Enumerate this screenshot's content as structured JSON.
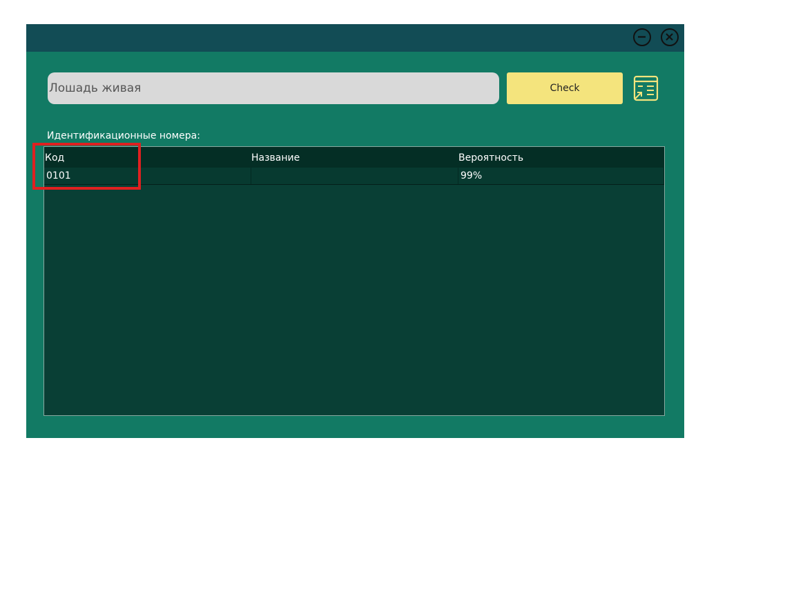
{
  "search": {
    "value": "Лошадь живая"
  },
  "toolbar": {
    "check_label": "Check"
  },
  "table": {
    "caption": "Идентификационные номера:",
    "columns": [
      "Код",
      "Название",
      "Вероятность"
    ],
    "rows": [
      {
        "code": "0101",
        "name": "",
        "probability": "99%"
      }
    ]
  },
  "colors": {
    "window_bg": "#127a64",
    "titlebar_bg": "#124c55",
    "grid_bg": "#093f35",
    "header_bg": "#042e25",
    "input_bg": "#d9d9d9",
    "button_bg": "#f4e47d",
    "icon_accent": "#f4e47d",
    "highlight": "#e02020"
  },
  "icons": {
    "minimize": "minimize-circle-icon",
    "close": "close-circle-icon",
    "report": "report-list-icon"
  }
}
